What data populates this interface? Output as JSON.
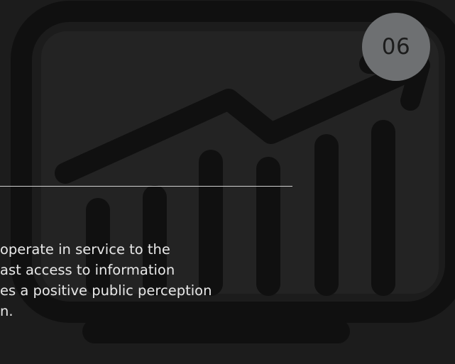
{
  "slide": {
    "number": "06",
    "text_lines": [
      "operate in service to the",
      "ast access to information",
      "es a positive public perception",
      "n."
    ]
  },
  "colors": {
    "background": "#1c1c1c",
    "illustration_fill": "#232323",
    "illustration_stroke": "#101010",
    "badge": "#6e7072",
    "text": "#e8e8e8",
    "divider": "#cfcfcf"
  },
  "icons": {
    "background_art": "monitor-trend-chart-icon"
  }
}
